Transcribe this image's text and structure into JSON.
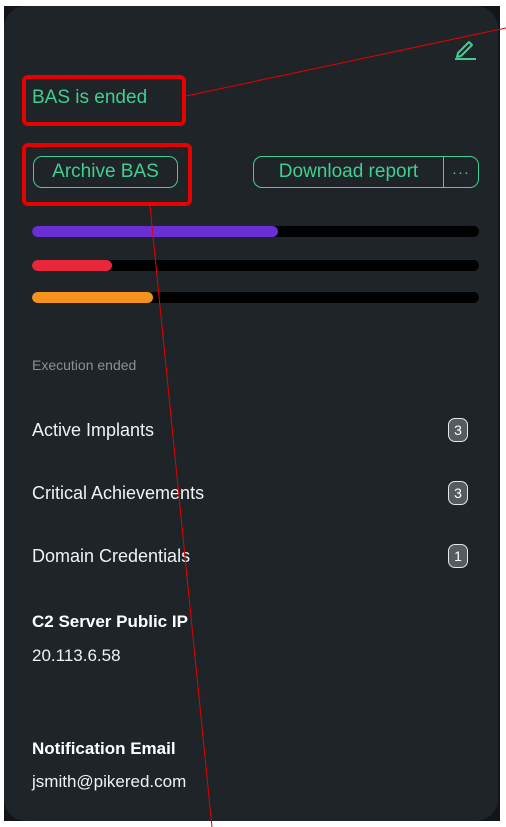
{
  "status": {
    "text": "BAS is ended"
  },
  "actions": {
    "archive_label": "Archive BAS",
    "download_label": "Download report",
    "more_label": "···"
  },
  "progress": [
    {
      "color": "#6a2fd4",
      "fraction": 0.55
    },
    {
      "color": "#e8283a",
      "fraction": 0.18
    },
    {
      "color": "#f5921e",
      "fraction": 0.27
    }
  ],
  "execution": {
    "label": "Execution ended",
    "stats": [
      {
        "name": "Active Implants",
        "count": "3"
      },
      {
        "name": "Critical Achievements",
        "count": "3"
      },
      {
        "name": "Domain Credentials",
        "count": "1"
      }
    ]
  },
  "c2_server": {
    "title": "C2 Server Public IP",
    "value": "20.113.6.58"
  },
  "notification": {
    "title": "Notification Email",
    "value": "jsmith@pikered.com"
  },
  "colors": {
    "accent": "#3fcf8e",
    "panel": "#1f2428",
    "highlight": "#e60000"
  },
  "icons": {
    "edit": "pencil-icon",
    "more": "more-dots-icon"
  }
}
